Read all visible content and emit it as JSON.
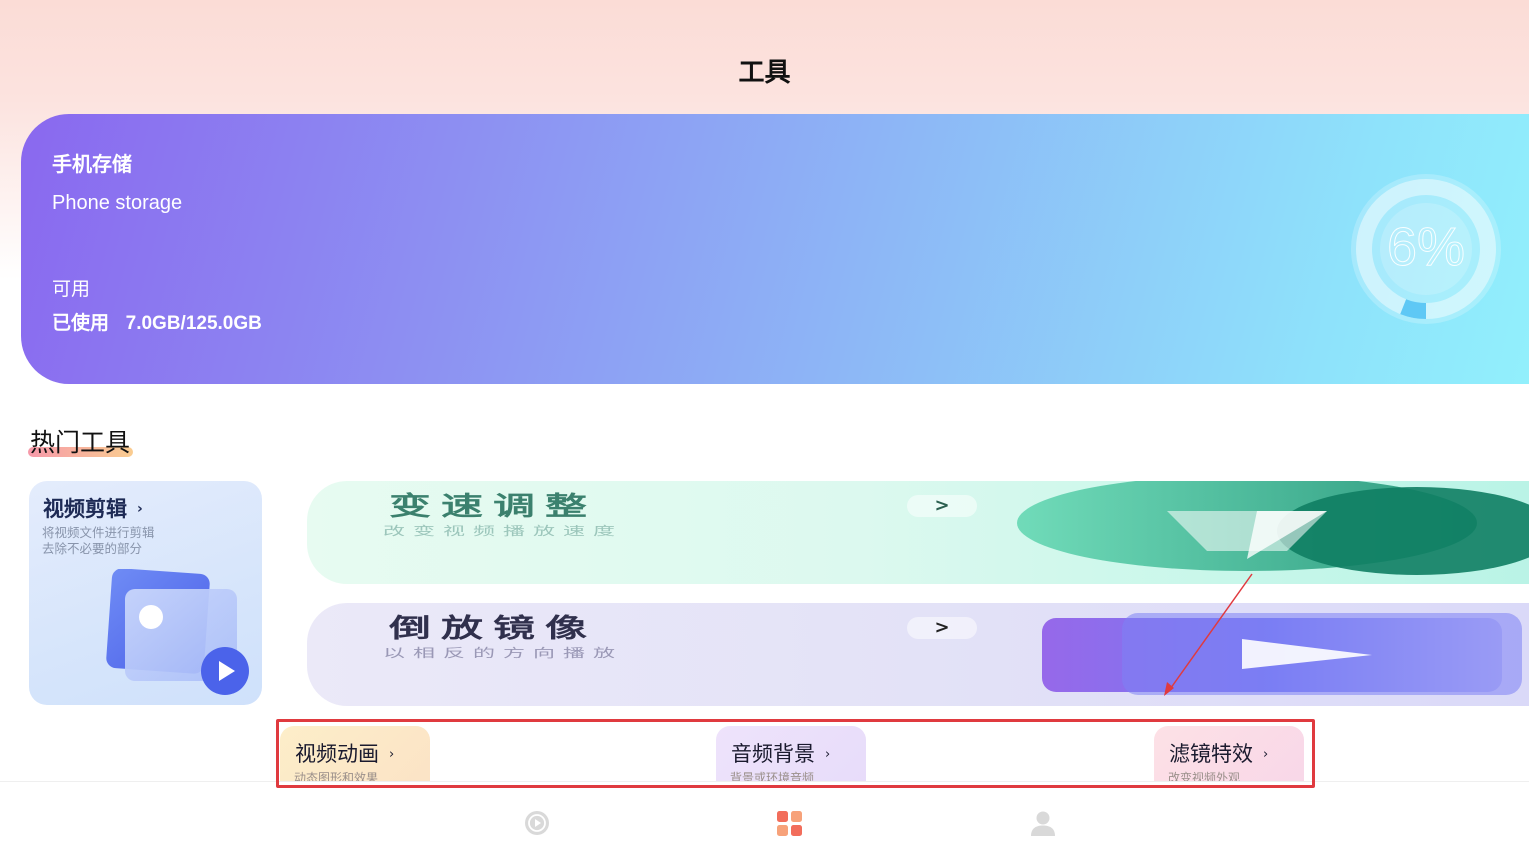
{
  "header": {
    "title": "工具"
  },
  "storage": {
    "title": "手机存储",
    "subtitle": "Phone storage",
    "available_label": "可用",
    "used_label": "已使用",
    "used_value": "7.0GB/125.0GB",
    "percent_text": "6%",
    "percent": 6
  },
  "hot_tools": {
    "title": "热门工具",
    "video_edit": {
      "title": "视频剪辑",
      "chevron": "›",
      "desc_line1": "将视频文件进行剪辑",
      "desc_line2": "去除不必要的部分"
    },
    "speed": {
      "title": "变速调整",
      "chevron": ">",
      "desc": "改变视频播放速度"
    },
    "reverse": {
      "title": "倒放镜像",
      "chevron": ">",
      "desc": "以相反的方向播放"
    },
    "small_cards": [
      {
        "title": "视频动画",
        "chevron": "›",
        "desc": "动态图形和效果"
      },
      {
        "title": "音频背景",
        "chevron": "›",
        "desc": "背景或环境音频"
      },
      {
        "title": "滤镜特效",
        "chevron": "›",
        "desc": "改变视频外观"
      }
    ]
  },
  "colors": {
    "accent_red": "#e03a3f",
    "tools_tab_active": "#f26d5b"
  },
  "bottom_nav": {
    "items": [
      {
        "icon": "play-circle-icon"
      },
      {
        "icon": "grid-apps-icon"
      },
      {
        "icon": "person-icon"
      }
    ]
  }
}
